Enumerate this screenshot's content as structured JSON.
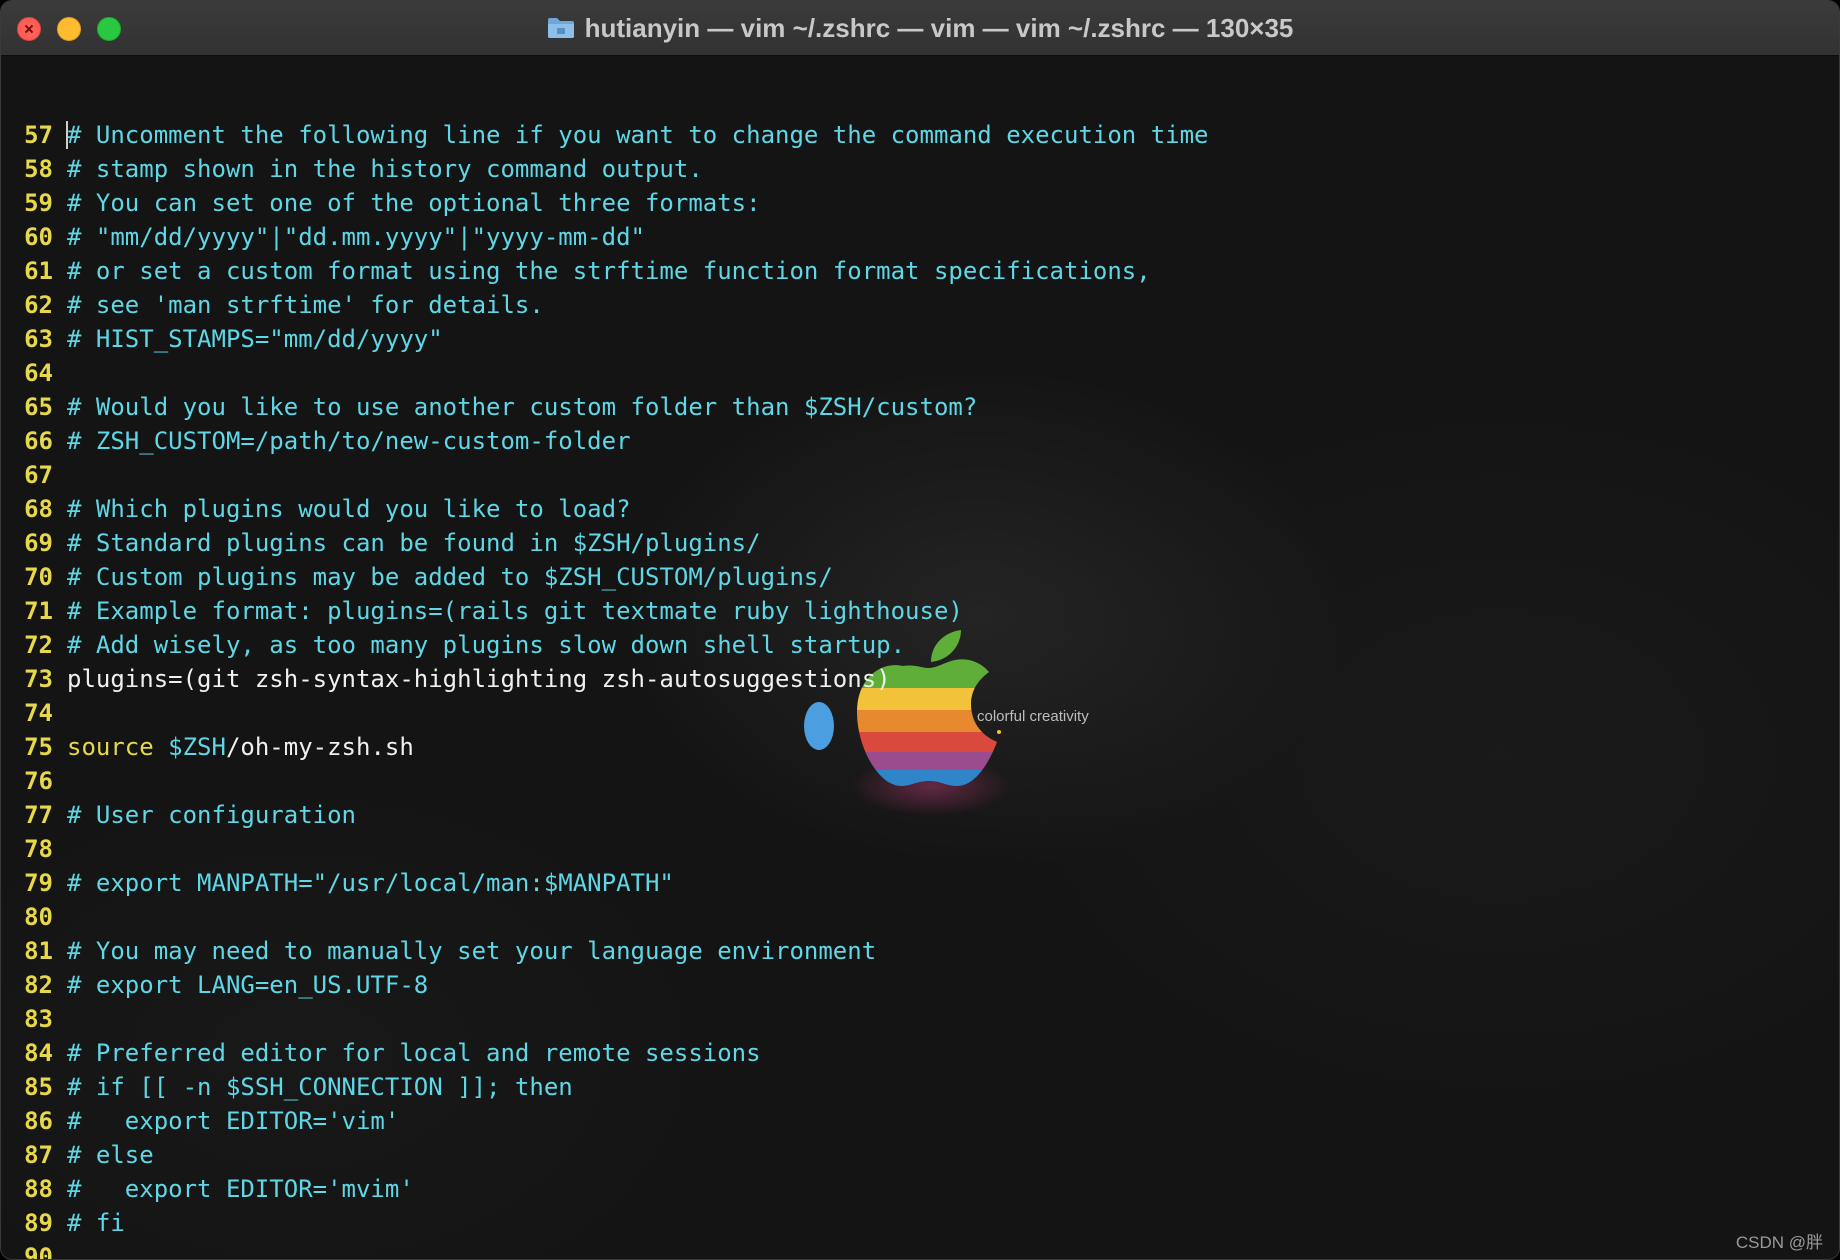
{
  "window": {
    "title": "hutianyin — vim ~/.zshrc — vim — vim ~/.zshrc — 130×35",
    "folder_icon": "folder-icon"
  },
  "colors": {
    "line_number": "#e6d84a",
    "comment": "#5fd7e6",
    "plain": "#f0f0f0",
    "keyword": "#e6d84a",
    "variable": "#5fd7e6"
  },
  "wallpaper": {
    "caption": "colorful creativity"
  },
  "editor": {
    "lines": [
      {
        "num": "57",
        "text": "# Uncomment the following line if you want to change the command execution time"
      },
      {
        "num": "58",
        "text": "# stamp shown in the history command output."
      },
      {
        "num": "59",
        "text": "# You can set one of the optional three formats:"
      },
      {
        "num": "60",
        "text": "# \"mm/dd/yyyy\"|\"dd.mm.yyyy\"|\"yyyy-mm-dd\""
      },
      {
        "num": "61",
        "text": "# or set a custom format using the strftime function format specifications,"
      },
      {
        "num": "62",
        "text": "# see 'man strftime' for details."
      },
      {
        "num": "63",
        "text": "# HIST_STAMPS=\"mm/dd/yyyy\""
      },
      {
        "num": "64",
        "text": ""
      },
      {
        "num": "65",
        "text": "# Would you like to use another custom folder than $ZSH/custom?"
      },
      {
        "num": "66",
        "text": "# ZSH_CUSTOM=/path/to/new-custom-folder"
      },
      {
        "num": "67",
        "text": ""
      },
      {
        "num": "68",
        "text": "# Which plugins would you like to load?"
      },
      {
        "num": "69",
        "text": "# Standard plugins can be found in $ZSH/plugins/"
      },
      {
        "num": "70",
        "text": "# Custom plugins may be added to $ZSH_CUSTOM/plugins/"
      },
      {
        "num": "71",
        "text": "# Example format: plugins=(rails git textmate ruby lighthouse)"
      },
      {
        "num": "72",
        "text": "# Add wisely, as too many plugins slow down shell startup."
      },
      {
        "num": "73",
        "text": "plugins=(git zsh-syntax-highlighting zsh-autosuggestions)"
      },
      {
        "num": "74",
        "text": ""
      },
      {
        "num": "75",
        "parts": {
          "keyword": "source",
          "space": " ",
          "var": "$ZSH",
          "rest": "/oh-my-zsh.sh"
        }
      },
      {
        "num": "76",
        "text": ""
      },
      {
        "num": "77",
        "text": "# User configuration"
      },
      {
        "num": "78",
        "text": ""
      },
      {
        "num": "79",
        "text": "# export MANPATH=\"/usr/local/man:$MANPATH\""
      },
      {
        "num": "80",
        "text": ""
      },
      {
        "num": "81",
        "text": "# You may need to manually set your language environment"
      },
      {
        "num": "82",
        "text": "# export LANG=en_US.UTF-8"
      },
      {
        "num": "83",
        "text": ""
      },
      {
        "num": "84",
        "text": "# Preferred editor for local and remote sessions"
      },
      {
        "num": "85",
        "text": "# if [[ -n $SSH_CONNECTION ]]; then"
      },
      {
        "num": "86",
        "text": "#   export EDITOR='vim'"
      },
      {
        "num": "87",
        "text": "# else"
      },
      {
        "num": "88",
        "text": "#   export EDITOR='mvim'"
      },
      {
        "num": "89",
        "text": "# fi"
      },
      {
        "num": "90",
        "text": ""
      }
    ]
  },
  "watermark": "CSDN @胖"
}
